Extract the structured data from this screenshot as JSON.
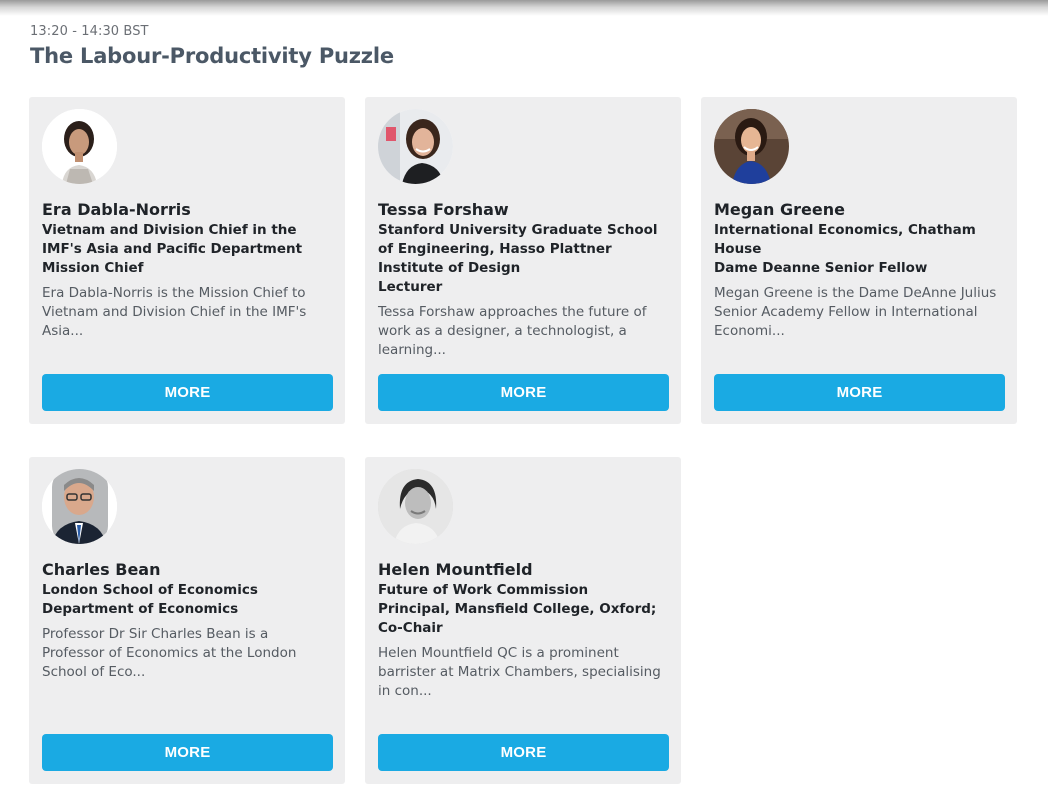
{
  "session": {
    "time": "13:20 - 14:30 BST",
    "title": "The Labour-Productivity Puzzle"
  },
  "colors": {
    "accent": "#1aaae3",
    "card_bg": "#eeeeef",
    "title": "#4b5866"
  },
  "speakers": [
    {
      "name": "Era Dabla-Norris",
      "organisation": "Vietnam and Division Chief in the IMF's Asia and Pacific Department",
      "role": "Mission Chief",
      "bio": "Era Dabla-Norris is the Mission Chief to Vietnam and Division Chief in the IMF's Asia...",
      "button": "MORE",
      "photo": "portrait-photo"
    },
    {
      "name": "Tessa Forshaw",
      "organisation": "Stanford University Graduate School of Engineering, Hasso Plattner Institute of Design",
      "role": "Lecturer",
      "bio": "Tessa Forshaw approaches the future of work as a designer, a technologist, a learning...",
      "button": "MORE",
      "photo": "portrait-photo"
    },
    {
      "name": "Megan Greene",
      "organisation": "International Economics, Chatham House",
      "role": "Dame Deanne Senior Fellow",
      "bio": "Megan Greene is the Dame DeAnne Julius Senior Academy Fellow in International Economi...",
      "button": "MORE",
      "photo": "portrait-photo"
    },
    {
      "name": "Charles Bean",
      "organisation": "London School of Economics",
      "role": "Department of Economics",
      "bio": "Professor Dr Sir Charles Bean is a Professor of Economics at the London School of Eco...",
      "button": "MORE",
      "photo": "portrait-photo"
    },
    {
      "name": "Helen Mountfield",
      "organisation": "Future of Work Commission",
      "role": "Principal, Mansfield College, Oxford; Co-Chair",
      "bio": "Helen Mountfield QC is a prominent barrister at Matrix Chambers, specialising in con...",
      "button": "MORE",
      "photo": "portrait-photo"
    }
  ]
}
